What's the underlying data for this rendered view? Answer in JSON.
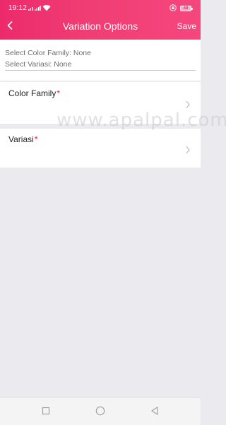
{
  "status_bar": {
    "time": "19:12",
    "battery": "49"
  },
  "toolbar": {
    "title": "Variation Options",
    "save_label": "Save",
    "back_icon": "chevron-left-icon"
  },
  "summary": {
    "color_family_line": "Select Color Family: None",
    "variasi_line": "Select Variasi: None"
  },
  "options": [
    {
      "label": "Color Family",
      "required_mark": "*"
    },
    {
      "label": "Variasi",
      "required_mark": "*"
    }
  ],
  "watermark": "www.apalpal.com",
  "colors": {
    "header_gradient_start": "#ec2a6b",
    "header_gradient_end": "#f5467d",
    "required_red": "#e8232b",
    "background": "#ebeaef"
  }
}
